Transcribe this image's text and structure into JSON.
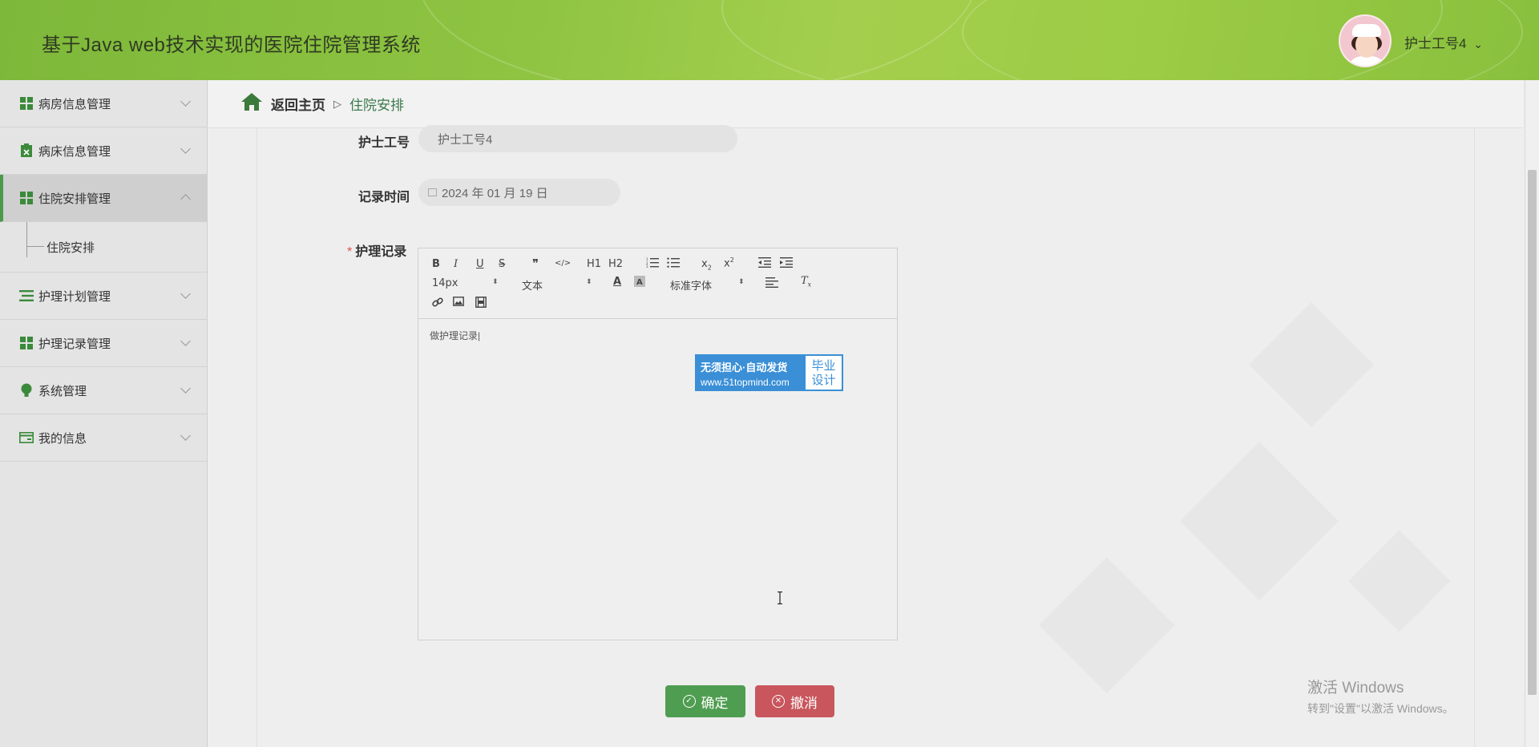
{
  "header": {
    "title": "基于Java web技术实现的医院住院管理系统",
    "user_name": "护士工号4",
    "user_caret": "⌄"
  },
  "sidebar": {
    "items": [
      {
        "label": "病房信息管理",
        "icon": "grid-icon"
      },
      {
        "label": "病床信息管理",
        "icon": "clipboard-x-icon"
      },
      {
        "label": "住院安排管理",
        "icon": "grid-icon",
        "open": true
      },
      {
        "label": "护理计划管理",
        "icon": "list-icon"
      },
      {
        "label": "护理记录管理",
        "icon": "grid-icon"
      },
      {
        "label": "系统管理",
        "icon": "lightbulb-icon"
      },
      {
        "label": "我的信息",
        "icon": "card-icon"
      }
    ],
    "submenu": {
      "label": "住院安排"
    }
  },
  "breadcrumb": {
    "back_label": "返回主页",
    "separator": "▷",
    "current": "住院安排"
  },
  "form": {
    "nurse_id_label": "护士工号",
    "nurse_id_value": "护士工号4",
    "record_time_label": "记录时间",
    "record_time_value": "2024 年 01 月 19 日",
    "required_mark": "*",
    "nursing_record_label": "护理记录",
    "editor": {
      "font_size": "14px",
      "text_type": "文本",
      "font_family": "标准字体",
      "content": "做护理记录|",
      "buttons": [
        "B",
        "I",
        "U",
        "S",
        "❞",
        "</>",
        "H1",
        "H2"
      ]
    }
  },
  "promo": {
    "line1": "无须担心·自动发货",
    "line2": "www.51topmind.com",
    "right1": "毕业",
    "right2": "设计"
  },
  "buttons": {
    "ok": "确定",
    "cancel": "撤消"
  },
  "watermark": {
    "line1": "激活 Windows",
    "line2": "转到\"设置\"以激活 Windows。"
  },
  "colors": {
    "header_green": "#8fc442",
    "accent_green": "#4f9d50",
    "danger_red": "#c8565c",
    "promo_blue": "#3a8fd6"
  }
}
